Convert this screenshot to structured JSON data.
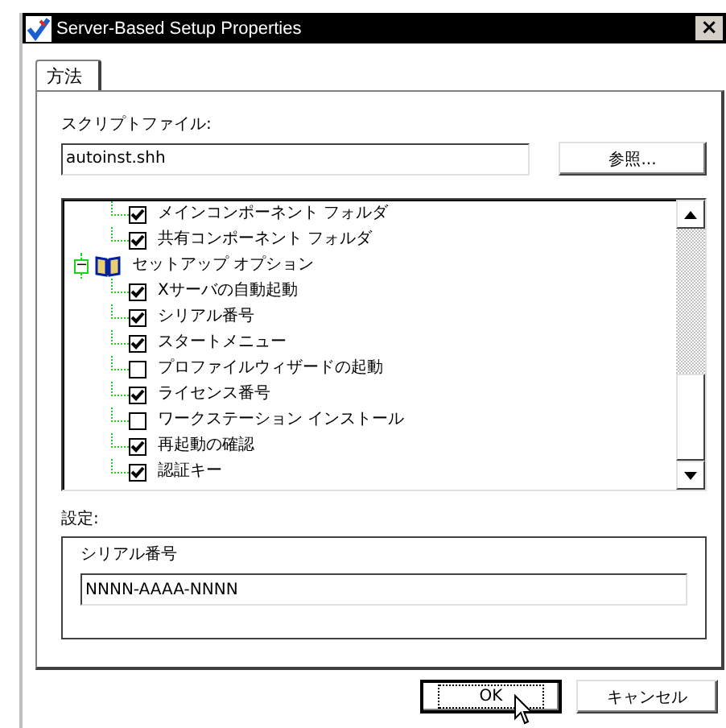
{
  "window": {
    "title": "Server-Based Setup Properties",
    "close": "×"
  },
  "tabs": [
    {
      "label": "方法",
      "selected": true
    }
  ],
  "script_file": {
    "label": "スクリプトファイル:",
    "value": "autoinst.shh",
    "browse": "参照..."
  },
  "tree": [
    {
      "kind": "option",
      "label": "メインコンポーネント フォルダ",
      "checked": true
    },
    {
      "kind": "option",
      "label": "共有コンポーネント フォルダ",
      "checked": true
    },
    {
      "kind": "folder",
      "label": "セットアップ オプション",
      "expanded": true,
      "expander": "−",
      "children": [
        {
          "kind": "option",
          "label": "Xサーバの自動起動",
          "checked": true
        },
        {
          "kind": "option",
          "label": "シリアル番号",
          "checked": true
        },
        {
          "kind": "option",
          "label": "スタートメニュー",
          "checked": true
        },
        {
          "kind": "option",
          "label": "プロファイルウィザードの起動",
          "checked": false
        },
        {
          "kind": "option",
          "label": "ライセンス番号",
          "checked": true
        },
        {
          "kind": "option",
          "label": "ワークステーション インストール",
          "checked": false
        },
        {
          "kind": "option",
          "label": "再起動の確認",
          "checked": true
        },
        {
          "kind": "option",
          "label": "認証キー",
          "checked": true
        }
      ]
    }
  ],
  "settings": {
    "label": "設定:",
    "group_title": "シリアル番号",
    "value": "NNNN-AAAA-NNNN"
  },
  "buttons": [
    {
      "label": "OK",
      "default": true
    },
    {
      "label": "キャンセル",
      "default": false
    }
  ]
}
